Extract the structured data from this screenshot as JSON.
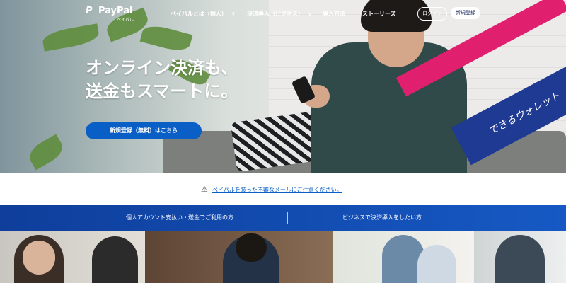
{
  "brand": {
    "name": "PayPal",
    "sub": "ペイパル",
    "mark": "P"
  },
  "nav": {
    "items": [
      {
        "label": "ペイパルとは（個人）",
        "has_dropdown": true
      },
      {
        "label": "決済導入（ビジネス）",
        "has_dropdown": true
      },
      {
        "label": "導入方法",
        "has_dropdown": false
      },
      {
        "label": "ストーリーズ",
        "has_dropdown": false
      }
    ],
    "login": "ログイン",
    "signup": "新規登録",
    "chevron": "∨"
  },
  "hero": {
    "headline_line1": "オンライン決済も、",
    "headline_line2": "送金もスマートに。",
    "cta": "新規登録（無料）はこちら",
    "badge_text": "できるウォレット"
  },
  "notice": {
    "icon": "⚠",
    "text": "ペイパルを装った不審なメールにご注意ください。"
  },
  "segments": [
    {
      "label": "個人アカウント支払い・送金でご利用の方"
    },
    {
      "label": "ビジネスで決済導入をしたい方"
    }
  ],
  "colors": {
    "primary": "#0a5fc7",
    "bar_start": "#0f3e9b",
    "bar_end": "#1659c4",
    "accent_pink": "#e0206e",
    "accent_navy": "#1f3a93"
  }
}
